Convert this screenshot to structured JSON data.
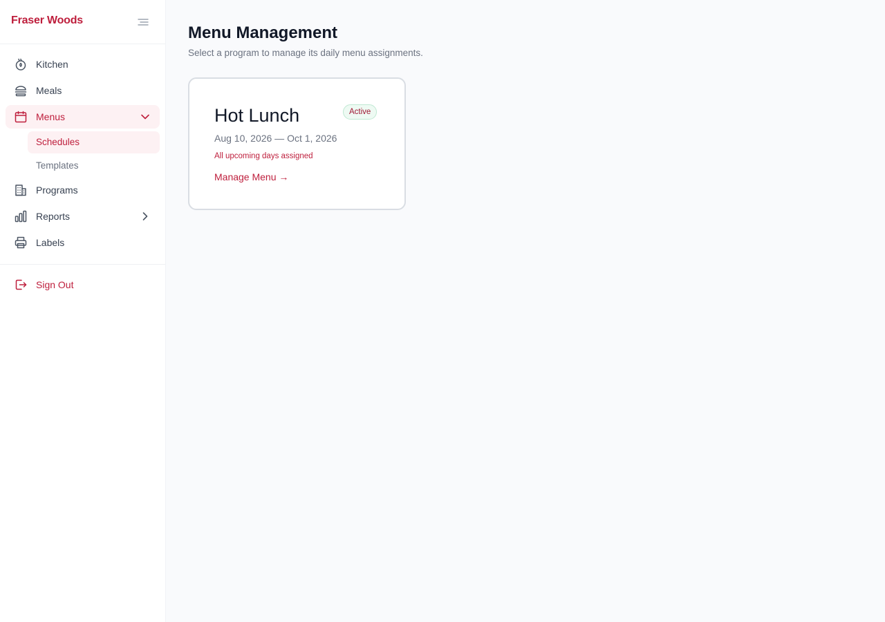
{
  "sidebar": {
    "brand": "Fraser Woods",
    "items": [
      {
        "label": "Kitchen",
        "icon": "kitchen-icon"
      },
      {
        "label": "Meals",
        "icon": "burger-icon"
      },
      {
        "label": "Menus",
        "icon": "calendar-icon",
        "expanded": true,
        "children": [
          {
            "label": "Schedules",
            "active": true
          },
          {
            "label": "Templates",
            "active": false
          }
        ]
      },
      {
        "label": "Programs",
        "icon": "building-icon"
      },
      {
        "label": "Reports",
        "icon": "bar-chart-icon",
        "expandable": true
      },
      {
        "label": "Labels",
        "icon": "printer-icon"
      }
    ],
    "sign_out": "Sign Out"
  },
  "main": {
    "title": "Menu Management",
    "subtitle": "Select a program to manage its daily menu assignments.",
    "cards": [
      {
        "title": "Hot Lunch",
        "badge": "Active",
        "dates": "Aug 10, 2026 — Oct 1, 2026",
        "status": "All upcoming days assigned",
        "link": "Manage Menu →"
      }
    ]
  },
  "colors": {
    "accent": "#be1e3c",
    "active_bg": "#fdf1f3",
    "badge_bg": "#eefaf3",
    "badge_border": "#bfe8d2",
    "page_bg": "#f9fafc"
  }
}
